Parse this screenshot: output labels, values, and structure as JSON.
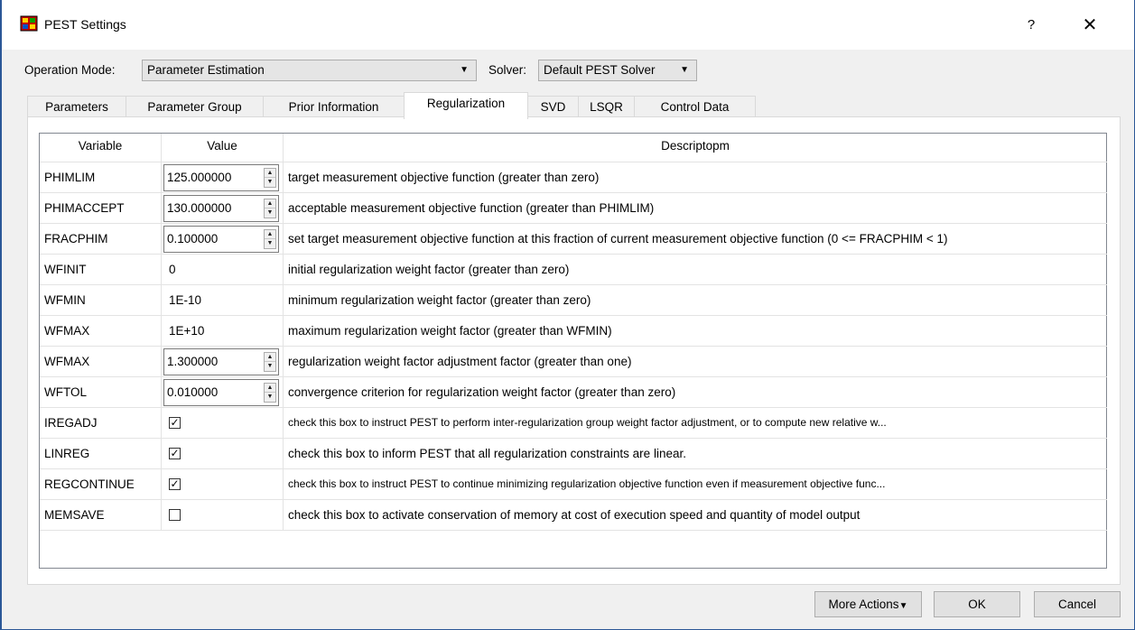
{
  "window": {
    "title": "PEST Settings",
    "icon": "pest-app-icon",
    "help_label": "?",
    "close_label": "✕"
  },
  "toolbar": {
    "operation_mode_label": "Operation Mode:",
    "operation_mode_value": "Parameter Estimation",
    "solver_label": "Solver:",
    "solver_value": "Default PEST Solver"
  },
  "tabs": [
    {
      "label": "Parameters",
      "active": false
    },
    {
      "label": "Parameter Group",
      "active": false
    },
    {
      "label": "Prior Information",
      "active": false
    },
    {
      "label": "Regularization",
      "active": true
    },
    {
      "label": "SVD",
      "active": false
    },
    {
      "label": "LSQR",
      "active": false
    },
    {
      "label": "Control Data",
      "active": false
    }
  ],
  "table": {
    "headers": {
      "variable": "Variable",
      "value": "Value",
      "description": "Descriptopm"
    },
    "rows": [
      {
        "variable": "PHIMLIM",
        "value": "125.000000",
        "kind": "spin",
        "description": "target measurement objective function (greater than zero)"
      },
      {
        "variable": "PHIMACCEPT",
        "value": "130.000000",
        "kind": "spin",
        "description": "acceptable measurement objective function  (greater than PHIMLIM)"
      },
      {
        "variable": "FRACPHIM",
        "value": "0.100000",
        "kind": "spin",
        "description": "set target measurement objective function at this fraction of current measurement objective function (0 <= FRACPHIM < 1)"
      },
      {
        "variable": "WFINIT",
        "value": "0",
        "kind": "text",
        "description": "initial regularization weight factor (greater than zero)"
      },
      {
        "variable": "WFMIN",
        "value": "1E-10",
        "kind": "text",
        "description": "minimum regularization weight factor (greater than zero)"
      },
      {
        "variable": "WFMAX",
        "value": "1E+10",
        "kind": "text",
        "description": "maximum regularization weight factor (greater than WFMIN)"
      },
      {
        "variable": "WFMAX",
        "value": "1.300000",
        "kind": "spin",
        "description": "regularization weight factor adjustment factor (greater than one)"
      },
      {
        "variable": "WFTOL",
        "value": "0.010000",
        "kind": "spin",
        "description": "convergence criterion for regularization weight factor (greater than zero)"
      },
      {
        "variable": "IREGADJ",
        "checked": true,
        "kind": "check",
        "description": "check this box to instruct PEST to perform inter-regularization group weight factor adjustment, or to compute new relative w..."
      },
      {
        "variable": "LINREG",
        "checked": true,
        "kind": "check",
        "description": "check this box  to inform PEST that all regularization constraints are linear."
      },
      {
        "variable": "REGCONTINUE",
        "checked": true,
        "kind": "check",
        "description": "check this box to instruct PEST to continue minimizing regularization objective function even if measurement objective func..."
      },
      {
        "variable": "MEMSAVE",
        "checked": false,
        "kind": "check",
        "description": "check this box to activate conservation of memory at cost of execution speed and quantity of model output"
      }
    ]
  },
  "footer": {
    "more_actions_label": "More Actions",
    "ok_label": "OK",
    "cancel_label": "Cancel"
  }
}
